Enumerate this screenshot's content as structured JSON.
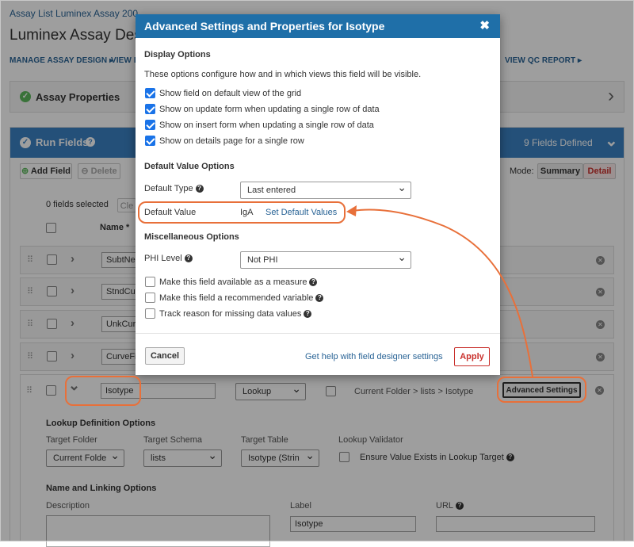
{
  "page": {
    "breadcrumb": "Assay List  Luminex Assay 200",
    "title": "Luminex Assay Desi",
    "nav": [
      "MANAGE ASSAY DESIGN ▸",
      "VIEW B",
      "VIEW QC REPORT ▸"
    ]
  },
  "assay_properties": {
    "label": "Assay Properties",
    "chevron": "›"
  },
  "run_fields": {
    "label": "Run Fields",
    "defined_count": "9 Fields Defined",
    "toolbar": {
      "add": "Add Field",
      "delete": "Delete",
      "mode_label": "Mode:",
      "summary": "Summary",
      "detail": "Detail"
    },
    "selected_text": "0 fields selected",
    "clear_label": "Cle",
    "name_header": "Name *",
    "rows": [
      {
        "name": "SubtNe"
      },
      {
        "name": "StndCu"
      },
      {
        "name": "UnkCur"
      },
      {
        "name": "CurveFi"
      }
    ],
    "expanded_row": {
      "name": "Isotype",
      "type": "Lookup",
      "lookup_path": "Current Folder > lists > Isotype",
      "advanced_button": "Advanced Settings"
    },
    "lookup": {
      "section": "Lookup Definition Options",
      "target_folder_label": "Target Folder",
      "target_folder_value": "Current Folde",
      "target_schema_label": "Target Schema",
      "target_schema_value": "lists",
      "target_table_label": "Target Table",
      "target_table_value": "Isotype (Strin",
      "validator_label": "Lookup Validator",
      "validator_option": "Ensure Value Exists in Lookup Target"
    },
    "linking": {
      "section": "Name and Linking Options",
      "description_label": "Description",
      "label_label": "Label",
      "label_value": "Isotype",
      "url_label": "URL"
    }
  },
  "modal": {
    "title": "Advanced Settings and Properties for Isotype",
    "close": "✖",
    "display_section": "Display Options",
    "display_desc": "These options configure how and in which views this field will be visible.",
    "display_options": [
      {
        "label": "Show field on default view of the grid",
        "checked": true
      },
      {
        "label": "Show on update form when updating a single row of data",
        "checked": true
      },
      {
        "label": "Show on insert form when updating a single row of data",
        "checked": true
      },
      {
        "label": "Show on details page for a single row",
        "checked": true
      }
    ],
    "default_section": "Default Value Options",
    "default_type_label": "Default Type",
    "default_type_value": "Last entered",
    "default_value_label": "Default Value",
    "default_value": "IgA",
    "set_default_link": "Set Default Values",
    "misc_section": "Miscellaneous Options",
    "phi_label": "PHI Level",
    "phi_value": "Not PHI",
    "misc_options": [
      {
        "label": "Make this field available as a measure",
        "checked": false
      },
      {
        "label": "Make this field a recommended variable",
        "checked": false
      },
      {
        "label": "Track reason for missing data values",
        "checked": false
      }
    ],
    "cancel": "Cancel",
    "help_link": "Get help with field designer settings",
    "apply": "Apply"
  },
  "colors": {
    "header_blue": "#1f6fa8",
    "panel_blue": "#3b82c4",
    "annotation": "#e8703a",
    "link": "#2a6496"
  }
}
